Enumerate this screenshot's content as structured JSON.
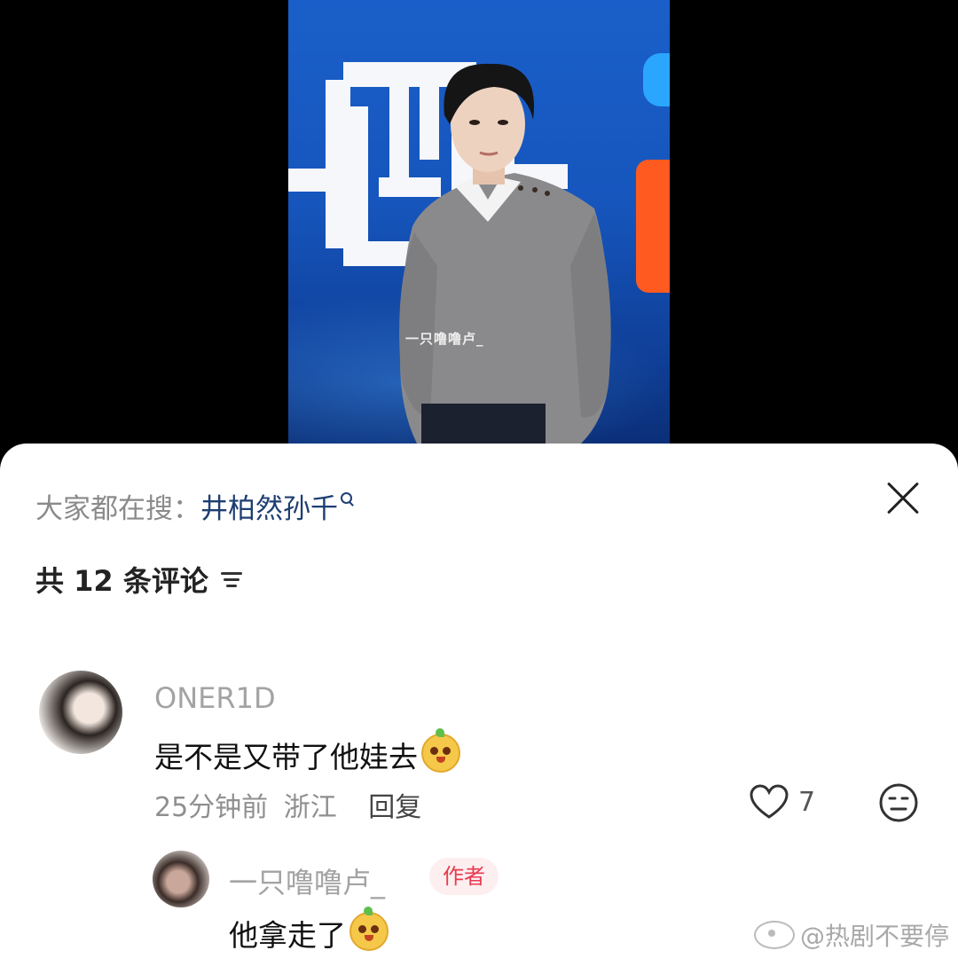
{
  "video": {
    "sign_chars": [
      "西"
    ],
    "watermark": "一只噜噜卢_"
  },
  "sheet": {
    "search_prefix": "大家都在搜：",
    "search_term": "井柏然孙千",
    "comment_count_label": "共 12 条评论"
  },
  "comments": [
    {
      "username": "ONER1D",
      "text": "是不是又带了他娃去",
      "time": "25分钟前",
      "location": "浙江",
      "reply_label": "回复",
      "likes": "7"
    }
  ],
  "reply": {
    "username": "一只噜噜卢_",
    "badge": "作者",
    "text": "他拿走了"
  },
  "weibo_watermark": "@热剧不要停",
  "colors": {
    "badge_text": "#ea3a4f",
    "badge_bg": "#fdeef0",
    "search_term": "#1e3e72"
  }
}
